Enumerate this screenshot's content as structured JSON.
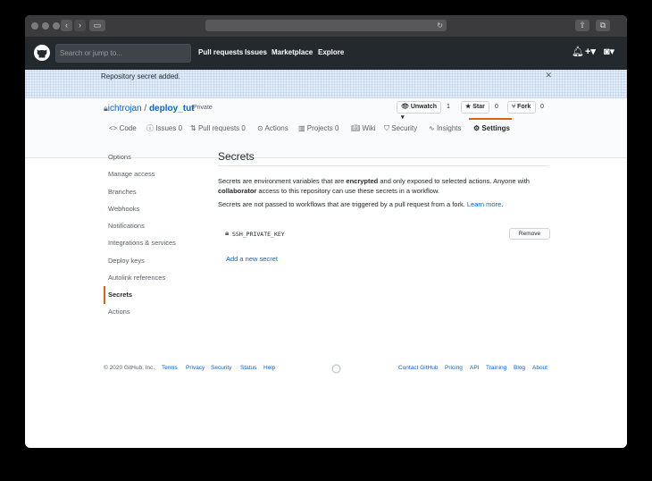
{
  "browser": {
    "tabs_icon": "sidebar-icon"
  },
  "header": {
    "search_placeholder": "Search or jump to...",
    "nav": [
      "Pull requests",
      "Issues",
      "Marketplace",
      "Explore"
    ]
  },
  "flash": {
    "message": "Repository secret added.",
    "close": "✕"
  },
  "repo": {
    "owner": "ichtrojan",
    "separator": " / ",
    "name": "deploy_tut",
    "visibility": "Private",
    "watch_label": "Unwatch ▾",
    "watch_count": "1",
    "star_label": "Star",
    "star_count": "0",
    "fork_label": "Fork",
    "fork_count": "0"
  },
  "tabs": [
    {
      "label": "Code"
    },
    {
      "label": "Issues",
      "count": "0"
    },
    {
      "label": "Pull requests",
      "count": "0"
    },
    {
      "label": "Actions"
    },
    {
      "label": "Projects",
      "count": "0"
    },
    {
      "label": "Wiki"
    },
    {
      "label": "Security"
    },
    {
      "label": "Insights"
    },
    {
      "label": "Settings"
    }
  ],
  "sidebar": [
    "Options",
    "Manage access",
    "Branches",
    "Webhooks",
    "Notifications",
    "Integrations & services",
    "Deploy keys",
    "Autolink references",
    "Secrets",
    "Actions"
  ],
  "main": {
    "title": "Secrets",
    "p1_a": "Secrets are environment variables that are ",
    "p1_b": "encrypted",
    "p1_c": " and only exposed to selected actions. Anyone with ",
    "p1_d": "collaborator",
    "p1_e": " access to this repository can use these secrets in a workflow.",
    "p2_a": "Secrets are not passed to workflows that are triggered by a pull request from a fork. ",
    "p2_link": "Learn more",
    "p2_end": ".",
    "secret_name": "SSH_PRIVATE_KEY",
    "remove": "Remove",
    "add_secret": "Add a new secret"
  },
  "footer": {
    "left": [
      "© 2020 GitHub, Inc.",
      "Terms",
      "Privacy",
      "Security",
      "Status",
      "Help"
    ],
    "right": [
      "Contact GitHub",
      "Pricing",
      "API",
      "Training",
      "Blog",
      "About"
    ]
  }
}
